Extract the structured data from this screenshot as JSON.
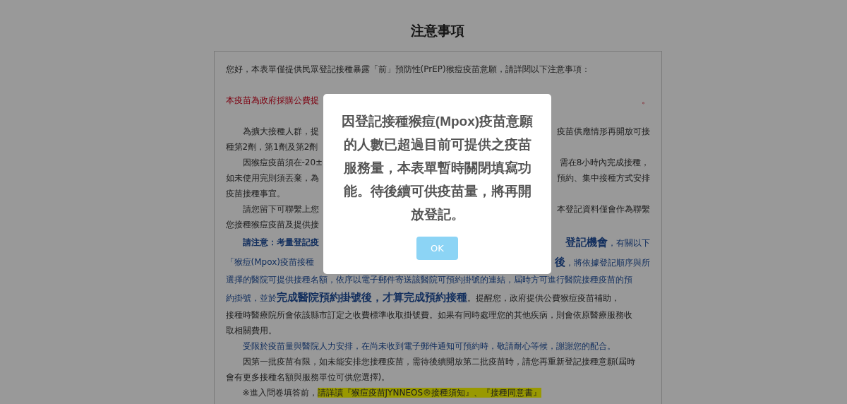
{
  "page": {
    "title": "注意事項"
  },
  "notice": {
    "lines": [
      {
        "indent": false,
        "spaced": false,
        "left": [
          {
            "kind": "normal",
            "text": "您好，本表單僅提供民眾登記接種暴露「前」預防性(PrEP)猴痘疫苗意願，請詳閱以下注意事項："
          }
        ]
      },
      {
        "indent": false,
        "spaced": true,
        "left": [
          {
            "kind": "red",
            "text": "本疫苗為政府採購公費提"
          }
        ],
        "right": [
          {
            "kind": "red",
            "text": "。"
          }
        ]
      },
      {
        "indent": true,
        "spaced": true,
        "left": [
          {
            "kind": "normal",
            "text": "為擴大接種人群，提"
          }
        ],
        "right": [
          {
            "kind": "normal",
            "text": "疫苗供應情形再開放可接"
          }
        ]
      },
      {
        "indent": false,
        "spaced": false,
        "left": [
          {
            "kind": "normal",
            "text": "種第2劑，第1劑及第2劑"
          }
        ]
      },
      {
        "indent": true,
        "spaced": false,
        "left": [
          {
            "kind": "normal",
            "text": "因猴痘疫苗須在-20±"
          }
        ],
        "right": [
          {
            "kind": "normal",
            "text": "需在8小時內完成接種，"
          }
        ]
      },
      {
        "indent": false,
        "spaced": false,
        "left": [
          {
            "kind": "normal",
            "text": "如未使用完則須丟棄，為"
          }
        ],
        "right": [
          {
            "kind": "normal",
            "text": "預約、集中接種方式安排"
          }
        ]
      },
      {
        "indent": false,
        "spaced": false,
        "left": [
          {
            "kind": "normal",
            "text": "疫苗接種事宜。"
          }
        ]
      },
      {
        "indent": true,
        "spaced": false,
        "left": [
          {
            "kind": "normal",
            "text": "請您留下可聯繫上您"
          }
        ],
        "right": [
          {
            "kind": "normal",
            "text": "本登記資料僅會作為聯繫"
          }
        ]
      },
      {
        "indent": false,
        "spaced": false,
        "left": [
          {
            "kind": "normal",
            "text": "您接種猴痘疫苗及提供接"
          }
        ]
      },
      {
        "indent": true,
        "spaced": false,
        "left": [
          {
            "kind": "blue-bold",
            "text": "請注意：考量登記疫"
          }
        ],
        "right": [
          {
            "kind": "blue-large",
            "text": "登記機會"
          },
          {
            "kind": "blue",
            "text": "，有關以下"
          }
        ]
      },
      {
        "indent": false,
        "spaced": false,
        "left": [
          {
            "kind": "blue",
            "text": "「猴痘(Mpox)疫苗接種"
          }
        ],
        "right": [
          {
            "kind": "blue-large",
            "text": "後"
          },
          {
            "kind": "blue",
            "text": "，將依據登記順序與所"
          }
        ]
      },
      {
        "indent": false,
        "spaced": false,
        "left": [
          {
            "kind": "blue",
            "text": "選擇的醫院可提供接種名額，依序以電子郵件寄送該醫院可預約掛號的連結，屆時方可進行醫院接種疫苗的預"
          }
        ]
      },
      {
        "indent": false,
        "spaced": false,
        "left": [
          {
            "kind": "blue",
            "text": "約掛號，並於"
          },
          {
            "kind": "blue-large",
            "text": "完成醫院預約掛號後，才算完成預約接種"
          },
          {
            "kind": "normal",
            "text": "。提醒您，政府提供公費猴痘疫苗補助，"
          }
        ]
      },
      {
        "indent": false,
        "spaced": false,
        "left": [
          {
            "kind": "normal",
            "text": "接種時醫療院所會依該縣市訂定之收費標準收取掛號費。如果有同時處理您的其他疾病，則會依原醫療服務收"
          }
        ]
      },
      {
        "indent": false,
        "spaced": false,
        "left": [
          {
            "kind": "normal",
            "text": "取相關費用。"
          }
        ]
      },
      {
        "indent": true,
        "spaced": false,
        "left": [
          {
            "kind": "blue",
            "text": "受限於疫苗量與醫院人力安排，在尚未收到電子郵件通知可預約時，敬請耐心等候，謝謝您的配合。"
          }
        ]
      },
      {
        "indent": true,
        "spaced": false,
        "left": [
          {
            "kind": "normal",
            "text": "因第一批疫苗有限，如未能安排您接種疫苗，需待後續開放第二批疫苗時，請您再重新登記接種意願(屆時"
          }
        ]
      },
      {
        "indent": false,
        "spaced": false,
        "left": [
          {
            "kind": "normal",
            "text": "會有更多接種名額與服務單位可供您選擇)。"
          }
        ]
      },
      {
        "indent": true,
        "spaced": false,
        "left": [
          {
            "kind": "normal",
            "text": "※進入問卷填答前，"
          },
          {
            "kind": "highlight",
            "text": "請詳讀『猴痘疫苗JYNNEOS®接種須知』、『接種同意書』"
          }
        ]
      }
    ]
  },
  "dialog": {
    "message": "因登記接種猴痘(Mpox)疫苗意願的人數已超過目前可提供之疫苗服務量，本表單暫時關閉填寫功能。待後續可供疫苗量，將再開放登記。",
    "button": "OK"
  }
}
